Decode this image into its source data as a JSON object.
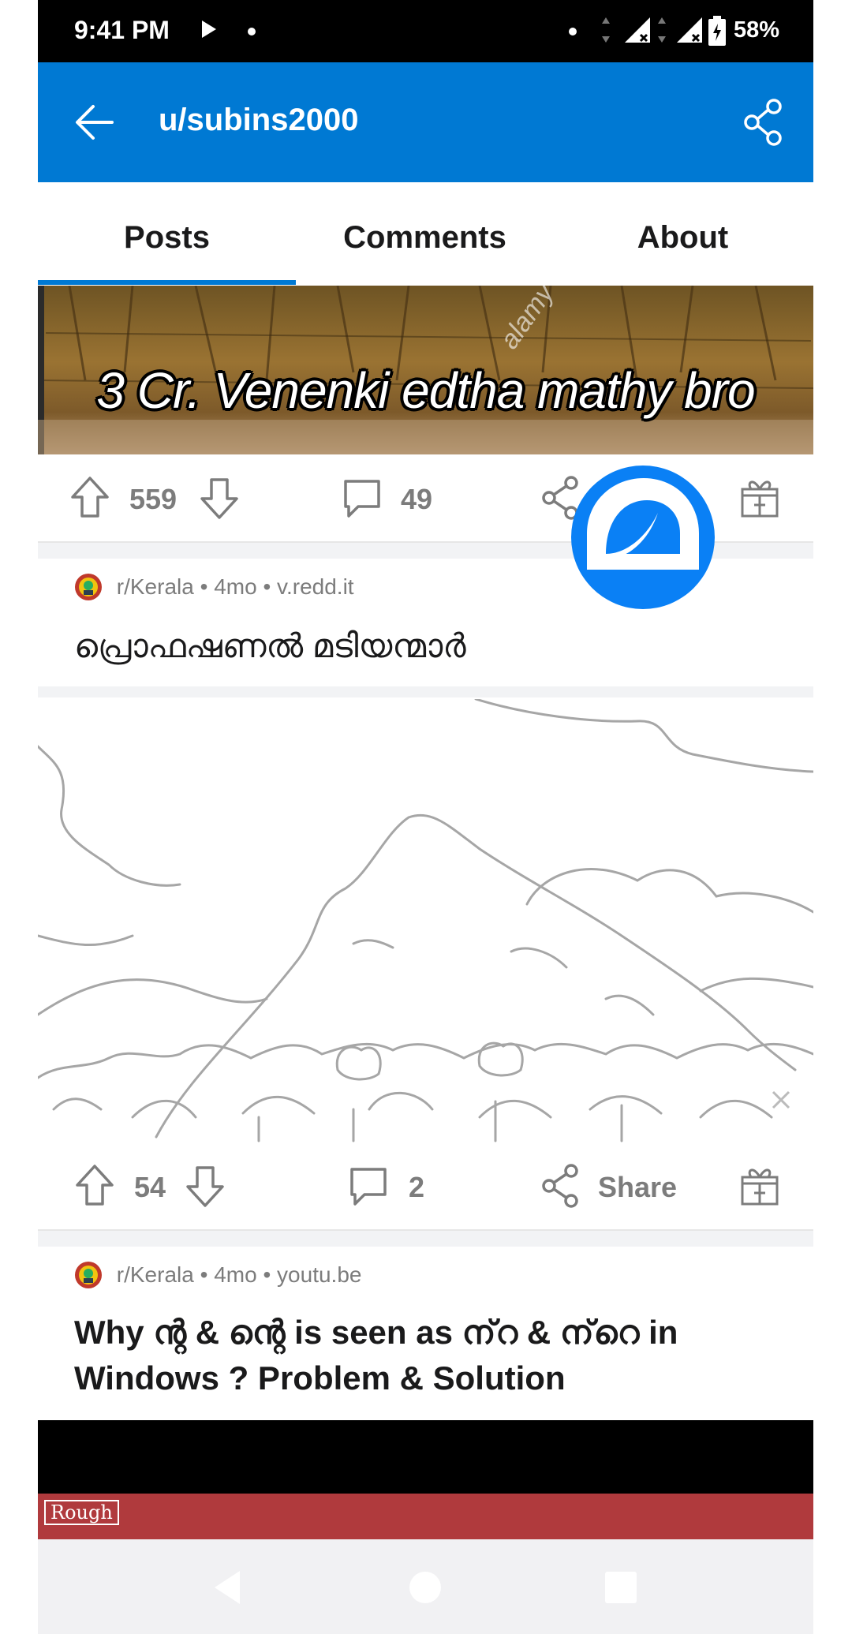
{
  "status_bar": {
    "time": "9:41 PM",
    "battery": "58%"
  },
  "app_bar": {
    "title": "u/subins2000",
    "back_icon": "arrow-left-icon",
    "share_icon": "share-icon"
  },
  "tabs": [
    {
      "label": "Posts",
      "selected": true
    },
    {
      "label": "Comments",
      "selected": false
    },
    {
      "label": "About",
      "selected": false
    }
  ],
  "posts": [
    {
      "image_caption": "3 Cr. Venenki edtha mathy bro",
      "watermark": "alamy",
      "upvotes": "559",
      "comments": "49"
    },
    {
      "subreddit": "r/Kerala",
      "age": "4mo",
      "domain": "v.redd.it",
      "title": "പ്രൊഫഷണൽ മടിയന്മാർ",
      "upvotes": "54",
      "comments": "2",
      "share_label": "Share"
    },
    {
      "subreddit": "r/Kerala",
      "age": "4mo",
      "domain": "youtu.be",
      "title_line1": "Why ന്റ & ന്റെ is seen as ന്‌റ & ന്‌റെ in",
      "title_line2": "Windows ? Problem & Solution",
      "thumbnail_text": "Rough"
    }
  ],
  "colors": {
    "brand_blue": "#0079d3",
    "badge_blue": "#0a80f5",
    "meta_gray": "#7c7c7c"
  }
}
